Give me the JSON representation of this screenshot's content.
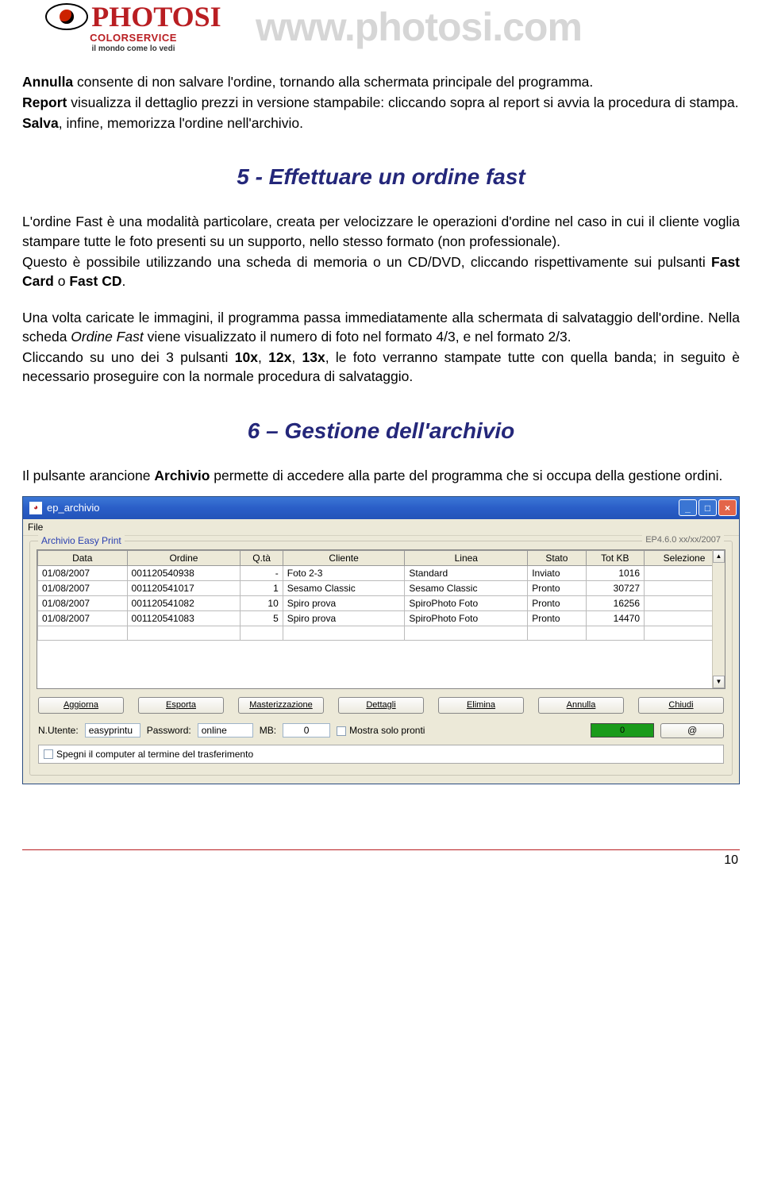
{
  "logo": {
    "brand": "PHOTOSI",
    "sub": "COLORSERVICE",
    "tagline": "il mondo come lo vedi"
  },
  "url": "www.photosi.com",
  "intro": {
    "p1a": "Annulla",
    "p1b": " consente di non salvare l'ordine, tornando alla schermata principale del programma.",
    "p2a": "Report",
    "p2b": " visualizza il dettaglio prezzi in versione stampabile: cliccando sopra al report si avvia la procedura di stampa.",
    "p3a": "Salva",
    "p3b": ", infine, memorizza l'ordine nell'archivio."
  },
  "h5": "5 - Effettuare un ordine fast",
  "sec5": {
    "p1": "L'ordine Fast è una modalità particolare, creata per velocizzare le operazioni d'ordine nel caso in cui il cliente voglia stampare tutte le foto presenti su un supporto, nello stesso formato (non professionale).",
    "p2_head": "Questo è possibile utilizzando una scheda di memoria o un CD/DVD, cliccando rispettivamente sui pulsanti ",
    "p2_b1": "Fast Card",
    "p2_mid": " o ",
    "p2_b2": "Fast CD",
    "p2_tail": ".",
    "p3_a": "Una volta caricate le immagini, il programma passa immediatamente alla schermata di salvataggio dell'ordine. Nella scheda ",
    "p3_i": "Ordine Fast",
    "p3_b": " viene visualizzato il numero di foto nel formato 4/3, e nel formato 2/3.",
    "p4_a": "Cliccando su uno dei 3 pulsanti ",
    "p4_b1": "10x",
    "p4_c1": ", ",
    "p4_b2": "12x",
    "p4_c2": ", ",
    "p4_b3": "13x",
    "p4_tail": ", le foto verranno stampate tutte con quella banda; in seguito è necessario proseguire con la normale procedura di salvataggio."
  },
  "h6": "6 – Gestione dell'archivio",
  "sec6": {
    "p1_a": "Il pulsante arancione ",
    "p1_b": "Archivio",
    "p1_c": " permette di accedere alla parte del programma che si occupa della gestione ordini."
  },
  "window": {
    "title": "ep_archivio",
    "menu_file": "File",
    "group_title": "Archivio Easy Print",
    "version": "EP4.6.0 xx/xx/2007",
    "cols": [
      "Data",
      "Ordine",
      "Q.tà",
      "Cliente",
      "Linea",
      "Stato",
      "Tot KB",
      "Selezione"
    ],
    "rows": [
      {
        "data": "01/08/2007",
        "ordine": "001120540938",
        "qta": "-",
        "cliente": "Foto 2-3",
        "linea": "Standard",
        "stato": "Inviato",
        "kb": "1016"
      },
      {
        "data": "01/08/2007",
        "ordine": "001120541017",
        "qta": "1",
        "cliente": "Sesamo Classic",
        "linea": "Sesamo Classic",
        "stato": "Pronto",
        "kb": "30727"
      },
      {
        "data": "01/08/2007",
        "ordine": "001120541082",
        "qta": "10",
        "cliente": "Spiro prova",
        "linea": "SpiroPhoto Foto",
        "stato": "Pronto",
        "kb": "16256"
      },
      {
        "data": "01/08/2007",
        "ordine": "001120541083",
        "qta": "5",
        "cliente": "Spiro prova",
        "linea": "SpiroPhoto Foto",
        "stato": "Pronto",
        "kb": "14470"
      }
    ],
    "buttons": [
      "Aggiorna",
      "Esporta",
      "Masterizzazione",
      "Dettagli",
      "Elimina",
      "Annulla",
      "Chiudi"
    ],
    "status": {
      "nutente": "N.Utente:",
      "nutente_val": "easyprintu",
      "password": "Password:",
      "password_val": "online",
      "mb": "MB:",
      "mb_val": "0",
      "mostra": "Mostra solo pronti",
      "led": "0",
      "at": "@"
    },
    "shutdown": "Spegni il computer al termine del trasferimento"
  },
  "page_number": "10"
}
